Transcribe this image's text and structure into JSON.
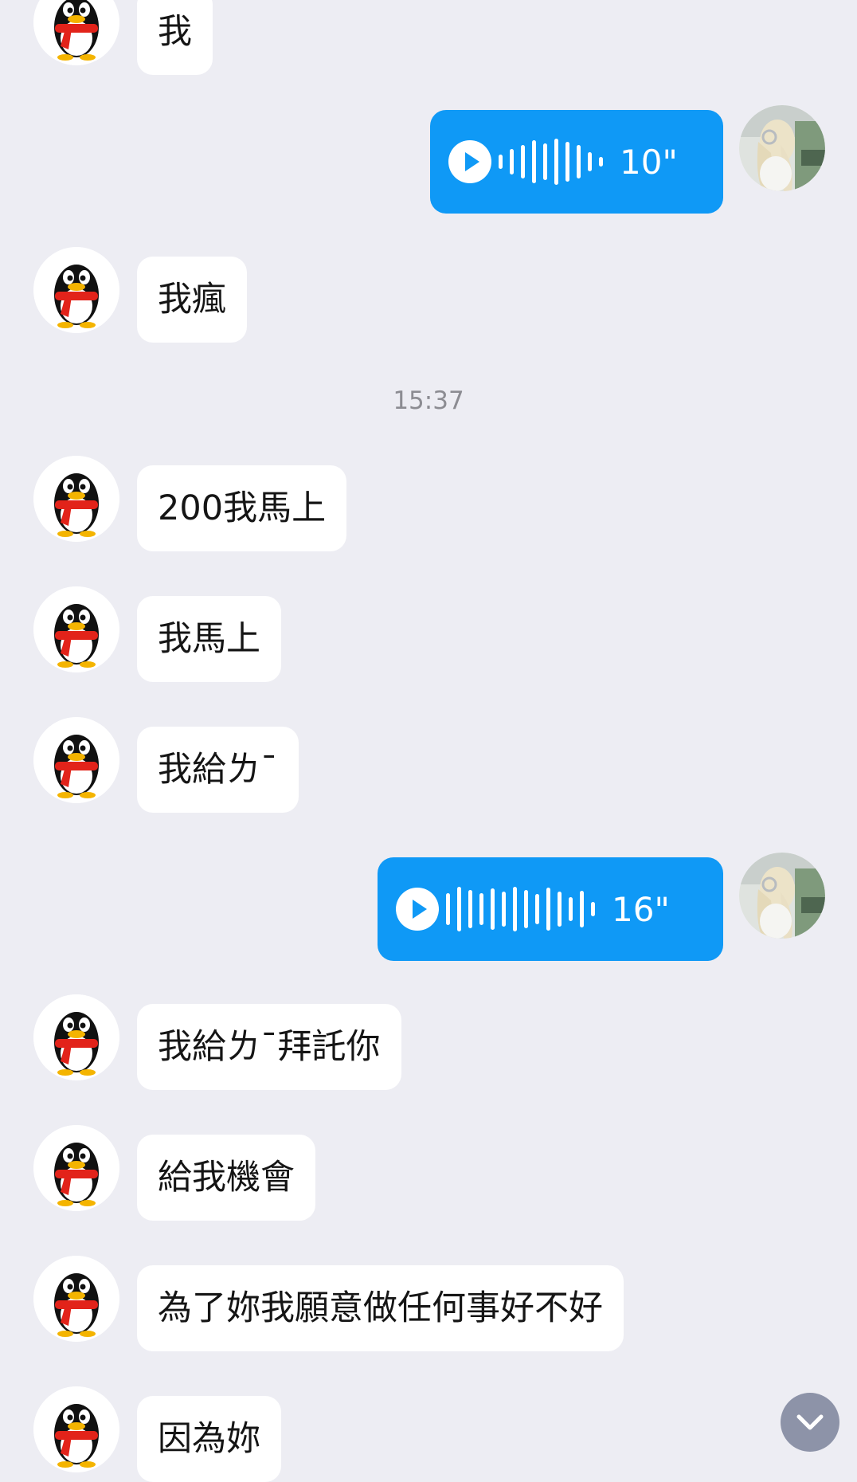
{
  "colors": {
    "background": "#ededf3",
    "peer_bubble": "#ffffff",
    "voice_bubble": "#0f99f6",
    "timestamp_text": "#8c8c92",
    "scroll_button": "#8d93a8"
  },
  "peer_avatar_icon": "qq-penguin-avatar-icon",
  "my_avatar_icon": "user-photo-avatar-icon",
  "scroll_down_icon": "chevron-down-icon",
  "messages": [
    {
      "type": "text",
      "sender": "peer",
      "text": "我"
    },
    {
      "type": "voice",
      "sender": "me",
      "duration": "10\"",
      "bars": 10
    },
    {
      "type": "text",
      "sender": "peer",
      "text": "我瘋"
    },
    {
      "type": "time",
      "text": "15:37"
    },
    {
      "type": "text",
      "sender": "peer",
      "text": "200我馬上"
    },
    {
      "type": "text",
      "sender": "peer",
      "text": "我馬上"
    },
    {
      "type": "text",
      "sender": "peer",
      "text": "我給ㄌˉ"
    },
    {
      "type": "voice",
      "sender": "me",
      "duration": "16\"",
      "bars": 14
    },
    {
      "type": "text",
      "sender": "peer",
      "text": "我給ㄌˉ拜託你"
    },
    {
      "type": "text",
      "sender": "peer",
      "text": "給我機會"
    },
    {
      "type": "text",
      "sender": "peer",
      "text": "為了妳我願意做任何事好不好"
    },
    {
      "type": "text",
      "sender": "peer",
      "text": "因為妳"
    }
  ]
}
